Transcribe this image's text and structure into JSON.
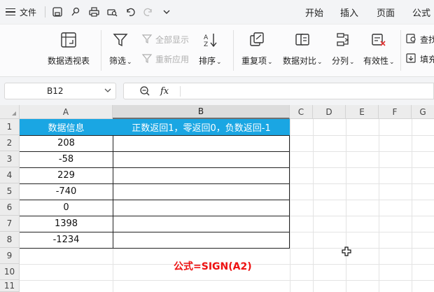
{
  "menubar": {
    "file_label": "文件",
    "tabs": [
      "开始",
      "插入",
      "页面",
      "公式"
    ]
  },
  "ribbon": {
    "pivot_label": "数据透视表",
    "filter_label": "筛选",
    "show_all_label": "全部显示",
    "reapply_label": "重新应用",
    "sort_label": "排序",
    "duplicate_label": "重复项",
    "compare_label": "数据对比",
    "split_label": "分列",
    "validity_label": "有效性",
    "find_label": "查找",
    "fill_label": "填充"
  },
  "formula_bar": {
    "cell_ref": "B12",
    "fx_label": "fx",
    "content": ""
  },
  "columns": [
    "A",
    "B",
    "C",
    "D",
    "E",
    "F",
    "G"
  ],
  "rows": [
    "1",
    "2",
    "3",
    "4",
    "5",
    "6",
    "7",
    "8",
    "9",
    "10",
    "11"
  ],
  "table": {
    "header_a": "数据信息",
    "header_b": "正数返回1，零返回0，负数返回-1",
    "values": [
      "208",
      "-58",
      "229",
      "-740",
      "0",
      "1398",
      "-1234"
    ]
  },
  "annotation": "公式=SIGN(A2)",
  "colors": {
    "header_fill": "#1aa6e3",
    "annotation": "#ee1111"
  }
}
